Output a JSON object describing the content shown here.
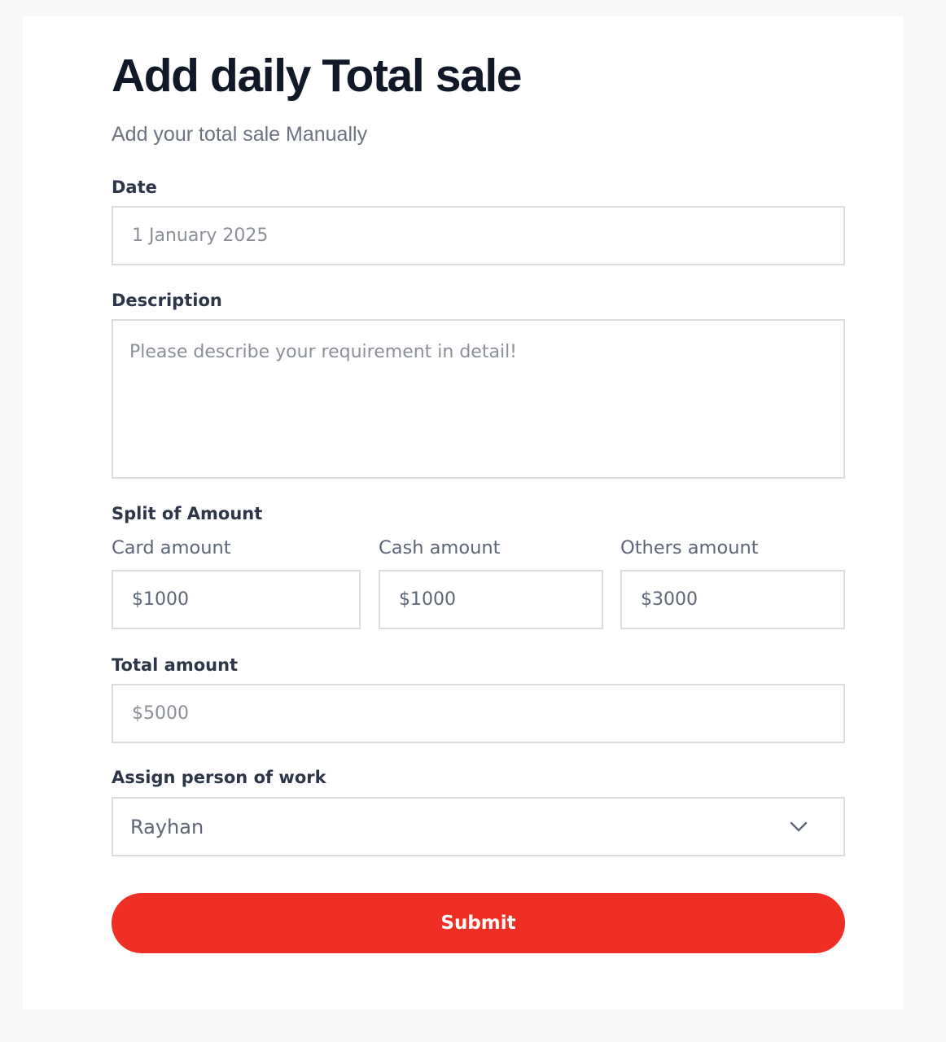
{
  "form": {
    "title": "Add daily Total sale",
    "subtitle": "Add your total sale Manually",
    "date": {
      "label": "Date",
      "value": "1 January 2025"
    },
    "description": {
      "label": "Description",
      "placeholder": "Please describe your requirement in detail!"
    },
    "split": {
      "label": "Split of Amount",
      "card": {
        "label": "Card amount",
        "value": "$1000"
      },
      "cash": {
        "label": "Cash amount",
        "value": "$1000"
      },
      "others": {
        "label": "Others amount",
        "value": "$3000"
      }
    },
    "total": {
      "label": "Total amount",
      "value": "$5000"
    },
    "assign": {
      "label": "Assign person of work",
      "value": "Rayhan",
      "icon": "chevron-down-icon"
    },
    "submit_label": "Submit"
  },
  "colors": {
    "accent": "#ef2e24",
    "title": "#111827",
    "label": "#2d3648",
    "muted": "#6b7280",
    "border": "#d9dce1"
  }
}
